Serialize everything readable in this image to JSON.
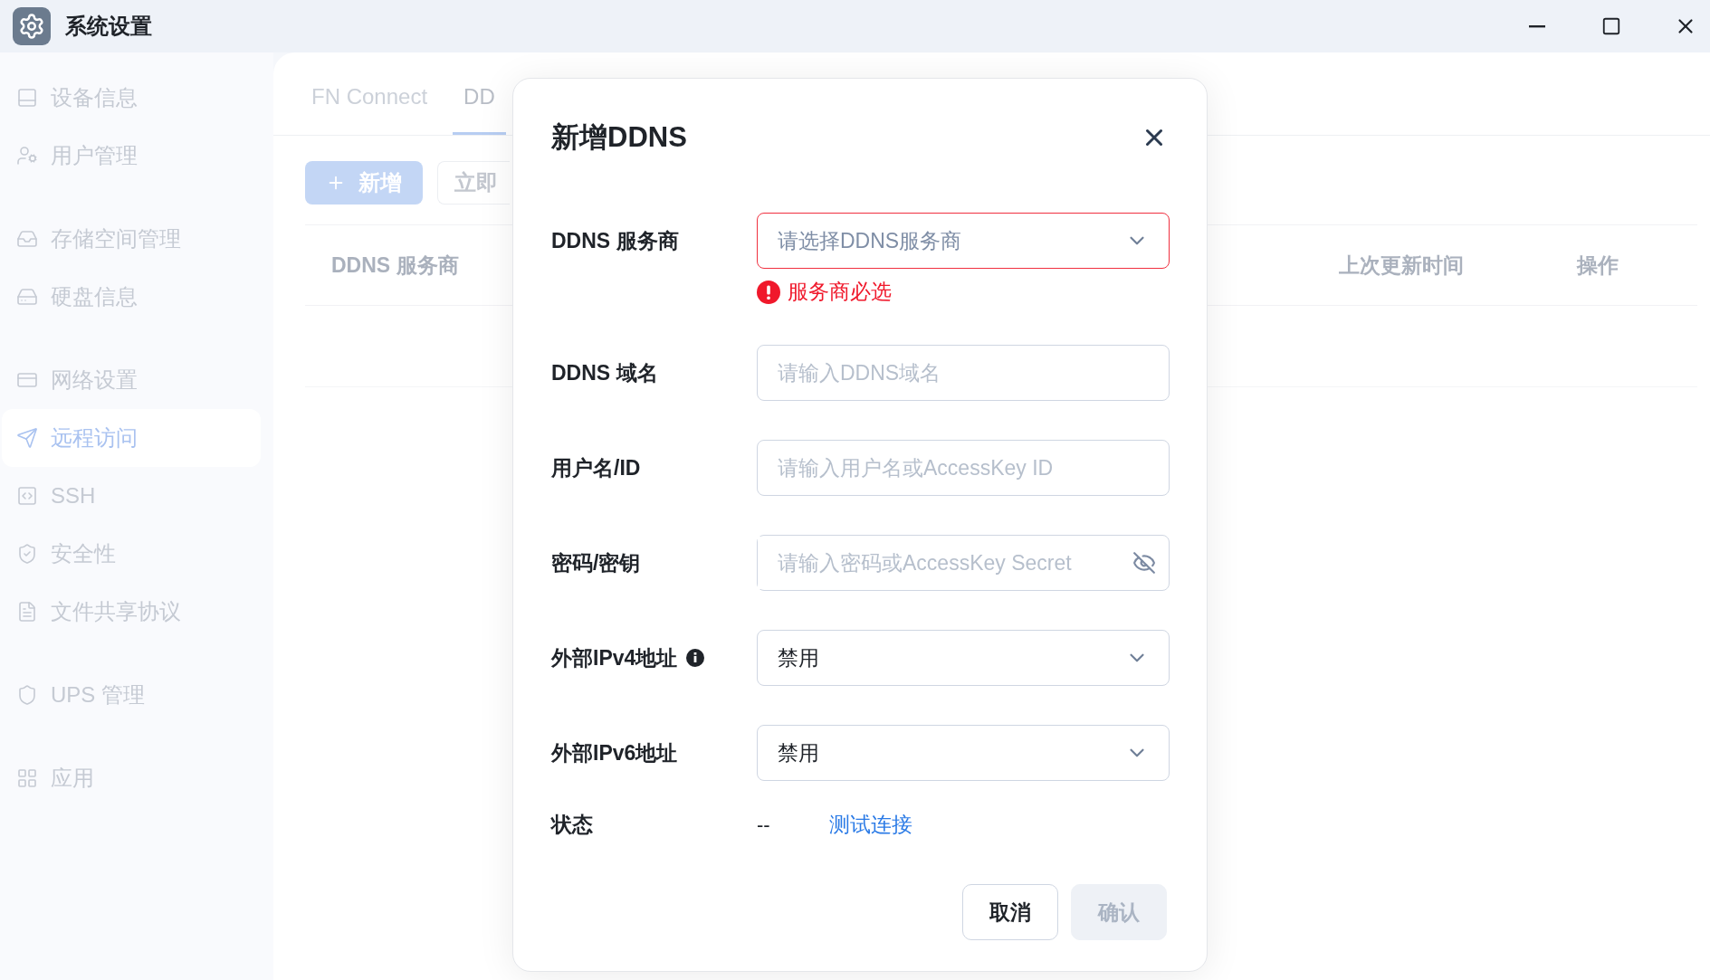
{
  "window": {
    "title": "系统设置"
  },
  "sidebar": {
    "groups": [
      {
        "items": [
          {
            "label": "设备信息",
            "selected": false
          },
          {
            "label": "用户管理",
            "selected": false
          }
        ]
      },
      {
        "items": [
          {
            "label": "存储空间管理",
            "selected": false
          },
          {
            "label": "硬盘信息",
            "selected": false
          }
        ]
      },
      {
        "items": [
          {
            "label": "网络设置",
            "selected": false
          },
          {
            "label": "远程访问",
            "selected": true
          },
          {
            "label": "SSH",
            "selected": false
          },
          {
            "label": "安全性",
            "selected": false
          },
          {
            "label": "文件共享协议",
            "selected": false
          }
        ]
      },
      {
        "items": [
          {
            "label": "UPS 管理",
            "selected": false
          }
        ]
      },
      {
        "items": [
          {
            "label": "应用",
            "selected": false
          }
        ]
      }
    ]
  },
  "tabs": [
    {
      "label": "FN Connect",
      "selected": false
    },
    {
      "label": "DD",
      "selected": true
    }
  ],
  "toolbar": {
    "add_button": "新增",
    "update_button": "立即"
  },
  "table": {
    "columns": [
      "DDNS 服务商",
      "上次更新时间",
      "操作"
    ]
  },
  "dialog": {
    "title": "新增DDNS",
    "fields": [
      {
        "kind": "select",
        "label": "DDNS 服务商",
        "placeholder": "请选择DDNS服务商",
        "error": "服务商必选",
        "info": false
      },
      {
        "kind": "text",
        "label": "DDNS 域名",
        "placeholder": "请输入DDNS域名",
        "info": false
      },
      {
        "kind": "text",
        "label": "用户名/ID",
        "placeholder": "请输入用户名或AccessKey ID",
        "info": false
      },
      {
        "kind": "password",
        "label": "密码/密钥",
        "placeholder": "请输入密码或AccessKey Secret",
        "info": false
      },
      {
        "kind": "select",
        "label": "外部IPv4地址",
        "value": "禁用",
        "info": true
      },
      {
        "kind": "select",
        "label": "外部IPv6地址",
        "value": "禁用",
        "info": false
      }
    ],
    "status": {
      "label": "状态",
      "value": "--",
      "link": "测试连接"
    },
    "buttons": [
      {
        "label": "取消",
        "disabled": false
      },
      {
        "label": "确认",
        "disabled": true
      }
    ]
  }
}
